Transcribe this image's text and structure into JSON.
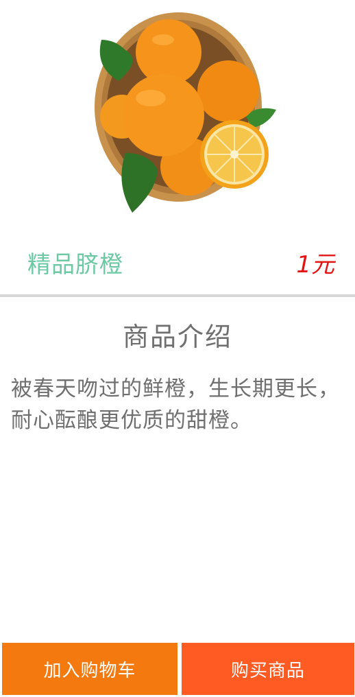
{
  "product": {
    "name": "精品脐橙",
    "price": "1元",
    "image": "orange-basket-image"
  },
  "intro": {
    "title": "商品介绍",
    "description": "被春天吻过的鲜橙，生长期更长，耐心酝酿更优质的甜橙。"
  },
  "actions": {
    "add_to_cart": "加入购物车",
    "buy_now": "购买商品"
  },
  "colors": {
    "name": "#6cc9a3",
    "price": "#e31414",
    "cart_button": "#f47a0f",
    "buy_button": "#ff5b23",
    "text": "#6f6f6f"
  }
}
